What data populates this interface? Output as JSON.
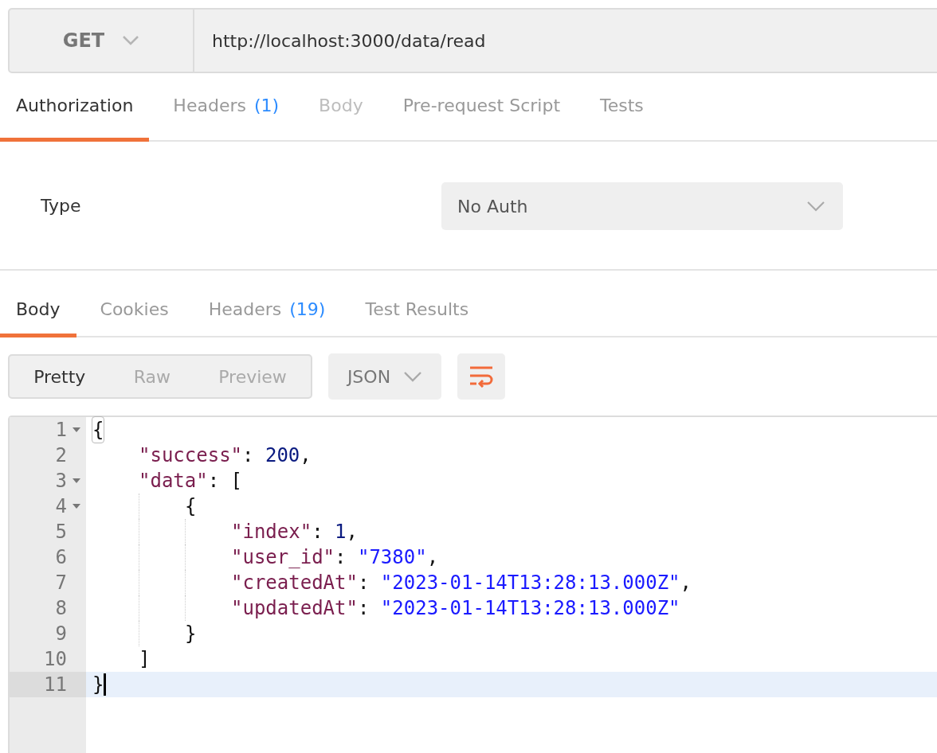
{
  "request": {
    "method": "GET",
    "url": "http://localhost:3000/data/read"
  },
  "request_tabs": [
    {
      "label": "Authorization",
      "selected": true,
      "disabled": false
    },
    {
      "label": "Headers",
      "count": "(1)",
      "selected": false,
      "disabled": false
    },
    {
      "label": "Body",
      "selected": false,
      "disabled": true
    },
    {
      "label": "Pre-request Script",
      "selected": false,
      "disabled": false
    },
    {
      "label": "Tests",
      "selected": false,
      "disabled": false
    }
  ],
  "auth": {
    "label": "Type",
    "value": "No Auth"
  },
  "response_tabs": [
    {
      "label": "Body",
      "selected": true
    },
    {
      "label": "Cookies",
      "selected": false
    },
    {
      "label": "Headers",
      "count": "(19)",
      "selected": false
    },
    {
      "label": "Test Results",
      "selected": false
    }
  ],
  "view_modes": [
    {
      "label": "Pretty",
      "selected": true
    },
    {
      "label": "Raw",
      "selected": false
    },
    {
      "label": "Preview",
      "selected": false
    }
  ],
  "format": {
    "value": "JSON"
  },
  "wrap_lines": {
    "on": true
  },
  "code_lines": [
    {
      "number": "1",
      "foldable": true,
      "current": false,
      "tokens": [
        {
          "kind": "punct",
          "text": "{"
        }
      ],
      "children": [
        {
          "number": "2",
          "foldable": false,
          "current": false,
          "tokens": [
            {
              "kind": "key",
              "text": "\"success\""
            },
            {
              "kind": "punct",
              "text": ": "
            },
            {
              "kind": "number",
              "text": "200"
            },
            {
              "kind": "punct",
              "text": ","
            }
          ]
        },
        {
          "number": "3",
          "foldable": true,
          "current": false,
          "tokens": [
            {
              "kind": "key",
              "text": "\"data\""
            },
            {
              "kind": "punct",
              "text": ": ["
            }
          ],
          "children": [
            {
              "number": "4",
              "foldable": true,
              "current": false,
              "tokens": [
                {
                  "kind": "punct",
                  "text": "{"
                }
              ],
              "children": [
                {
                  "number": "5",
                  "foldable": false,
                  "current": false,
                  "tokens": [
                    {
                      "kind": "key",
                      "text": "\"index\""
                    },
                    {
                      "kind": "punct",
                      "text": ": "
                    },
                    {
                      "kind": "number",
                      "text": "1"
                    },
                    {
                      "kind": "punct",
                      "text": ","
                    }
                  ]
                },
                {
                  "number": "6",
                  "foldable": false,
                  "current": false,
                  "tokens": [
                    {
                      "kind": "key",
                      "text": "\"user_id\""
                    },
                    {
                      "kind": "punct",
                      "text": ": "
                    },
                    {
                      "kind": "string",
                      "text": "\"7380\""
                    },
                    {
                      "kind": "punct",
                      "text": ","
                    }
                  ]
                },
                {
                  "number": "7",
                  "foldable": false,
                  "current": false,
                  "tokens": [
                    {
                      "kind": "key",
                      "text": "\"createdAt\""
                    },
                    {
                      "kind": "punct",
                      "text": ": "
                    },
                    {
                      "kind": "string",
                      "text": "\"2023-01-14T13:28:13.000Z\""
                    },
                    {
                      "kind": "punct",
                      "text": ","
                    }
                  ]
                },
                {
                  "number": "8",
                  "foldable": false,
                  "current": false,
                  "tokens": [
                    {
                      "kind": "key",
                      "text": "\"updatedAt\""
                    },
                    {
                      "kind": "punct",
                      "text": ": "
                    },
                    {
                      "kind": "string",
                      "text": "\"2023-01-14T13:28:13.000Z\""
                    }
                  ]
                }
              ]
            },
            {
              "number": "9",
              "foldable": false,
              "current": false,
              "tokens": [
                {
                  "kind": "punct",
                  "text": "}"
                }
              ]
            }
          ]
        },
        {
          "number": "10",
          "foldable": false,
          "current": false,
          "tokens": [
            {
              "kind": "punct",
              "text": "]"
            }
          ]
        }
      ]
    },
    {
      "number": "11",
      "foldable": false,
      "current": true,
      "tokens": [
        {
          "kind": "punct",
          "text": "}"
        }
      ]
    }
  ]
}
